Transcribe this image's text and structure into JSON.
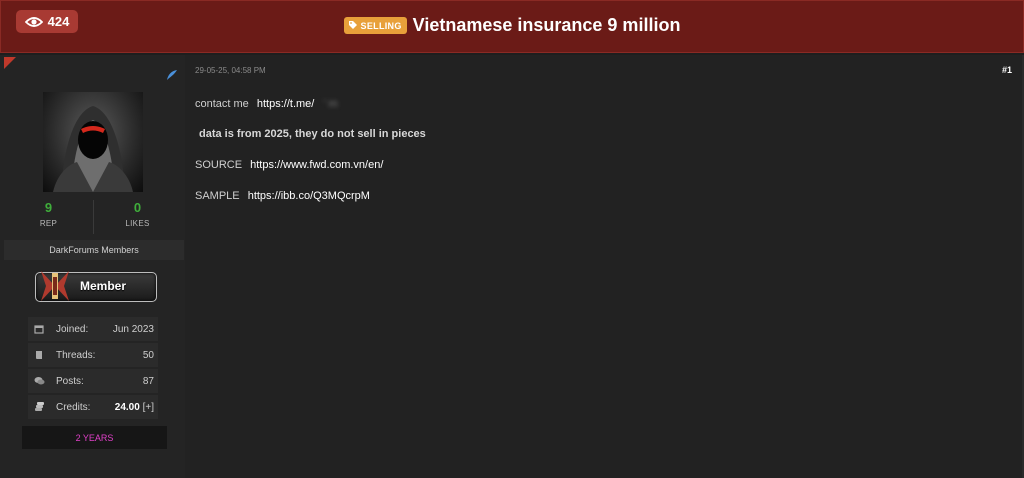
{
  "header": {
    "views": "424",
    "prefix_badge": "SELLING",
    "title": "Vietnamese insurance 9 million"
  },
  "author": {
    "rep_value": "9",
    "rep_label": "REP",
    "likes_value": "0",
    "likes_label": "LIKES",
    "group": "DarkForums Members",
    "rank_badge": "Member",
    "info": [
      {
        "icon": "calendar-icon",
        "key": "Joined:",
        "value": "Jun 2023"
      },
      {
        "icon": "book-icon",
        "key": "Threads:",
        "value": "50"
      },
      {
        "icon": "comments-icon",
        "key": "Posts:",
        "value": "87"
      },
      {
        "icon": "coins-icon",
        "key": "Credits:",
        "value": "24.00",
        "extra": "[+]"
      }
    ],
    "years": "2 YEARS"
  },
  "post": {
    "date": "29-05-25, 04:58 PM",
    "number": "#1",
    "contact_label": "contact me",
    "contact_link": "https://t.me/",
    "contact_hidden": "’ m",
    "note": "data is from 2025, they do not sell in pieces",
    "source_label": "SOURCE",
    "source_link": "https://www.fwd.com.vn/en/",
    "sample_label": "SAMPLE",
    "sample_link": "https://ibb.co/Q3MQcrpM"
  },
  "colors": {
    "header_bg": "#6b1b17",
    "accent_green": "#3fae3b",
    "years_text": "#e040c8",
    "badge_orange": "#e8a03a"
  }
}
